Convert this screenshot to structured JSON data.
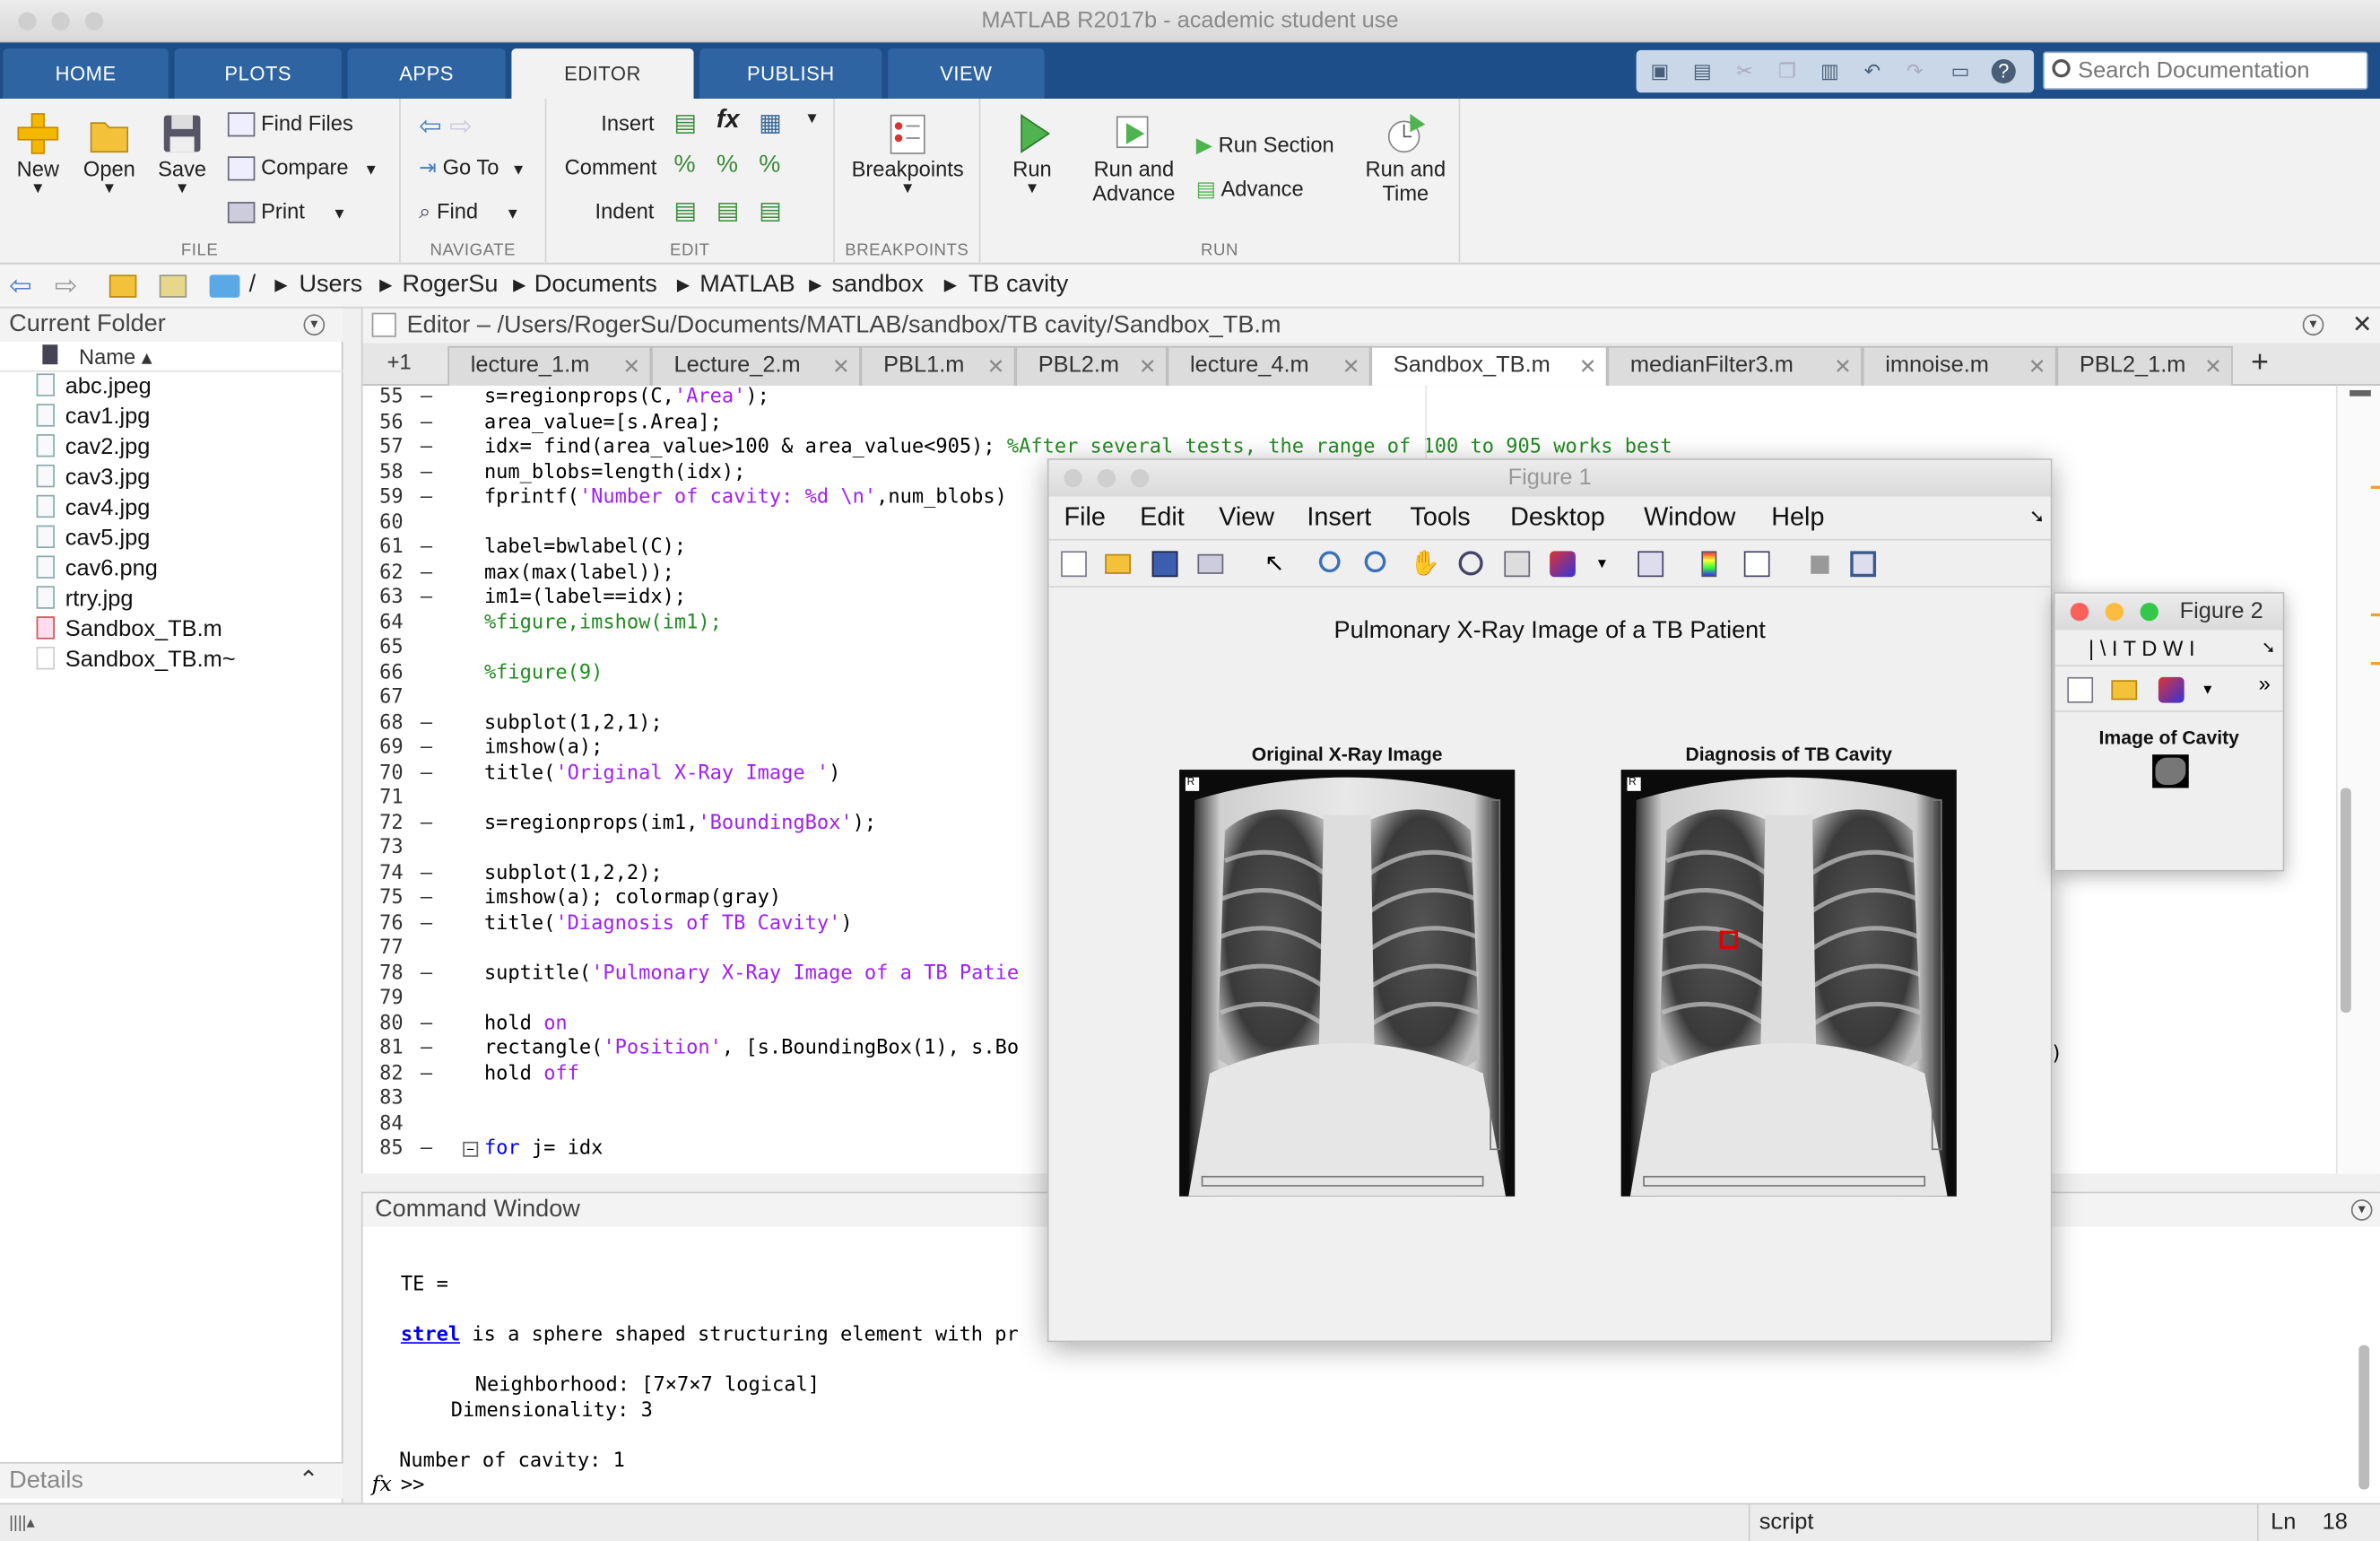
{
  "window": {
    "title": "MATLAB R2017b - academic student use"
  },
  "tabs": [
    {
      "label": "HOME"
    },
    {
      "label": "PLOTS"
    },
    {
      "label": "APPS"
    },
    {
      "label": "EDITOR"
    },
    {
      "label": "PUBLISH"
    },
    {
      "label": "VIEW"
    }
  ],
  "search": {
    "placeholder": "Search Documentation"
  },
  "ribbon": {
    "file": {
      "label": "FILE",
      "new": "New",
      "open": "Open",
      "save": "Save",
      "find_files": "Find Files",
      "compare": "Compare",
      "print": "Print"
    },
    "navigate": {
      "label": "NAVIGATE",
      "go_to": "Go To",
      "find": "Find"
    },
    "edit": {
      "label": "EDIT",
      "insert": "Insert",
      "comment": "Comment",
      "indent": "Indent",
      "fx": "fx"
    },
    "breakpoints": {
      "label": "BREAKPOINTS",
      "breakpoints": "Breakpoints"
    },
    "run": {
      "label": "RUN",
      "run": "Run",
      "run_and_advance_1": "Run and",
      "run_and_advance_2": "Advance",
      "run_section": "Run Section",
      "advance": "Advance",
      "run_and_time_1": "Run and",
      "run_and_time_2": "Time"
    }
  },
  "address": {
    "root": "/",
    "path": [
      "Users",
      "RogerSu",
      "Documents",
      "MATLAB",
      "sandbox",
      "TB cavity"
    ]
  },
  "current_folder": {
    "title": "Current Folder",
    "name_header": "Name ▴",
    "files": [
      "abc.jpeg",
      "cav1.jpg",
      "cav2.jpg",
      "cav3.jpg",
      "cav4.jpg",
      "cav5.jpg",
      "cav6.png",
      "rtry.jpg",
      "Sandbox_TB.m",
      "Sandbox_TB.m~"
    ],
    "details": "Details"
  },
  "editor": {
    "title": "Editor – /Users/RogerSu/Documents/MATLAB/sandbox/TB cavity/Sandbox_TB.m",
    "plus_one": "+1",
    "tabs": [
      "lecture_1.m",
      "Lecture_2.m",
      "PBL1.m",
      "PBL2.m",
      "lecture_4.m",
      "Sandbox_TB.m",
      "medianFilter3.m",
      "imnoise.m",
      "PBL2_1.m"
    ],
    "add_tab": "+",
    "lines": [
      {
        "n": "55",
        "d": "–",
        "t": [
          [
            "s=regionprops(C,",
            ""
          ],
          [
            "'Area'",
            "s"
          ],
          [
            ");",
            ""
          ]
        ]
      },
      {
        "n": "56",
        "d": "–",
        "t": [
          [
            "area_value=[s.Area];",
            ""
          ]
        ]
      },
      {
        "n": "57",
        "d": "–",
        "t": [
          [
            "idx= find(area_value>100 & area_value<905); ",
            ""
          ],
          [
            "%After several tests, the range of 100 to 905 works best",
            "c"
          ]
        ]
      },
      {
        "n": "58",
        "d": "–",
        "t": [
          [
            "num_blobs=length(idx);",
            ""
          ]
        ]
      },
      {
        "n": "59",
        "d": "–",
        "t": [
          [
            "fprintf(",
            ""
          ],
          [
            "'Number of cavity: %d \\n'",
            "s"
          ],
          [
            ",num_blobs)",
            ""
          ]
        ]
      },
      {
        "n": "60",
        "d": "",
        "t": []
      },
      {
        "n": "61",
        "d": "–",
        "t": [
          [
            "label=bwlabel(C);",
            ""
          ]
        ]
      },
      {
        "n": "62",
        "d": "–",
        "t": [
          [
            "max(max(label));",
            ""
          ]
        ]
      },
      {
        "n": "63",
        "d": "–",
        "t": [
          [
            "im1=(label==idx);",
            ""
          ]
        ]
      },
      {
        "n": "64",
        "d": "",
        "t": [
          [
            "%figure,imshow(im1);",
            "c"
          ]
        ]
      },
      {
        "n": "65",
        "d": "",
        "t": []
      },
      {
        "n": "66",
        "d": "",
        "t": [
          [
            "%figure(9)",
            "c"
          ]
        ]
      },
      {
        "n": "67",
        "d": "",
        "t": []
      },
      {
        "n": "68",
        "d": "–",
        "t": [
          [
            "subplot(1,2,1);",
            ""
          ]
        ]
      },
      {
        "n": "69",
        "d": "–",
        "t": [
          [
            "imshow(a);",
            ""
          ]
        ]
      },
      {
        "n": "70",
        "d": "–",
        "t": [
          [
            "title(",
            ""
          ],
          [
            "'Original X-Ray Image '",
            "s"
          ],
          [
            ")",
            ""
          ]
        ]
      },
      {
        "n": "71",
        "d": "",
        "t": []
      },
      {
        "n": "72",
        "d": "–",
        "t": [
          [
            "s=regionprops(im1,",
            ""
          ],
          [
            "'BoundingBox'",
            "s"
          ],
          [
            ");",
            ""
          ]
        ]
      },
      {
        "n": "73",
        "d": "",
        "t": []
      },
      {
        "n": "74",
        "d": "–",
        "t": [
          [
            "subplot(1,2,2);",
            ""
          ]
        ]
      },
      {
        "n": "75",
        "d": "–",
        "t": [
          [
            "imshow(a); colormap(gray)",
            ""
          ]
        ]
      },
      {
        "n": "76",
        "d": "–",
        "t": [
          [
            "title(",
            ""
          ],
          [
            "'Diagnosis of TB Cavity'",
            "s"
          ],
          [
            ")",
            ""
          ]
        ]
      },
      {
        "n": "77",
        "d": "",
        "t": []
      },
      {
        "n": "78",
        "d": "–",
        "t": [
          [
            "suptitle(",
            ""
          ],
          [
            "'Pulmonary X-Ray Image of a TB Patie",
            "s"
          ]
        ]
      },
      {
        "n": "79",
        "d": "",
        "t": []
      },
      {
        "n": "80",
        "d": "–",
        "t": [
          [
            "hold ",
            ""
          ],
          [
            "on",
            "s"
          ]
        ]
      },
      {
        "n": "81",
        "d": "–",
        "t": [
          [
            "rectangle(",
            ""
          ],
          [
            "'Position'",
            "s"
          ],
          [
            ", [s.BoundingBox(1), s.Bo",
            ""
          ]
        ]
      },
      {
        "n": "82",
        "d": "–",
        "t": [
          [
            "hold ",
            ""
          ],
          [
            "off",
            "s"
          ]
        ]
      },
      {
        "n": "83",
        "d": "",
        "t": []
      },
      {
        "n": "84",
        "d": "",
        "t": []
      },
      {
        "n": "85",
        "d": "–",
        "t": [
          [
            "for",
            "k"
          ],
          [
            " j= idx",
            ""
          ]
        ]
      }
    ],
    "line81_tail": ")"
  },
  "command_window": {
    "title": "Command Window",
    "te": "TE =",
    "strel_link": "strel",
    "strel_rest": " is a sphere shaped structuring element with pr",
    "neighborhood": "Neighborhood: [7×7×7 logical]",
    "dimensionality": "Dimensionality: 3",
    "cavity": "Number of cavity: 1",
    "fx": "fx",
    "prompt": ">>"
  },
  "status": {
    "mode": "script",
    "ln_label": "Ln",
    "ln_value": "18"
  },
  "figure1": {
    "title": "Figure 1",
    "menu": [
      "File",
      "Edit",
      "View",
      "Insert",
      "Tools",
      "Desktop",
      "Window",
      "Help"
    ],
    "suptitle": "Pulmonary X-Ray Image of a TB Patient",
    "left_title": "Original X-Ray Image",
    "right_title": "Diagnosis of TB Cavity",
    "marker": "R"
  },
  "figure2": {
    "title": "Figure 2",
    "title_chars": "| \\ I T D W I",
    "title_label": "Image of Cavity",
    "more": "»"
  },
  "colors": {
    "ribbon_blue": "#1d4e89",
    "tab_blue": "#2f64a3",
    "rect_red": "#e00000"
  }
}
